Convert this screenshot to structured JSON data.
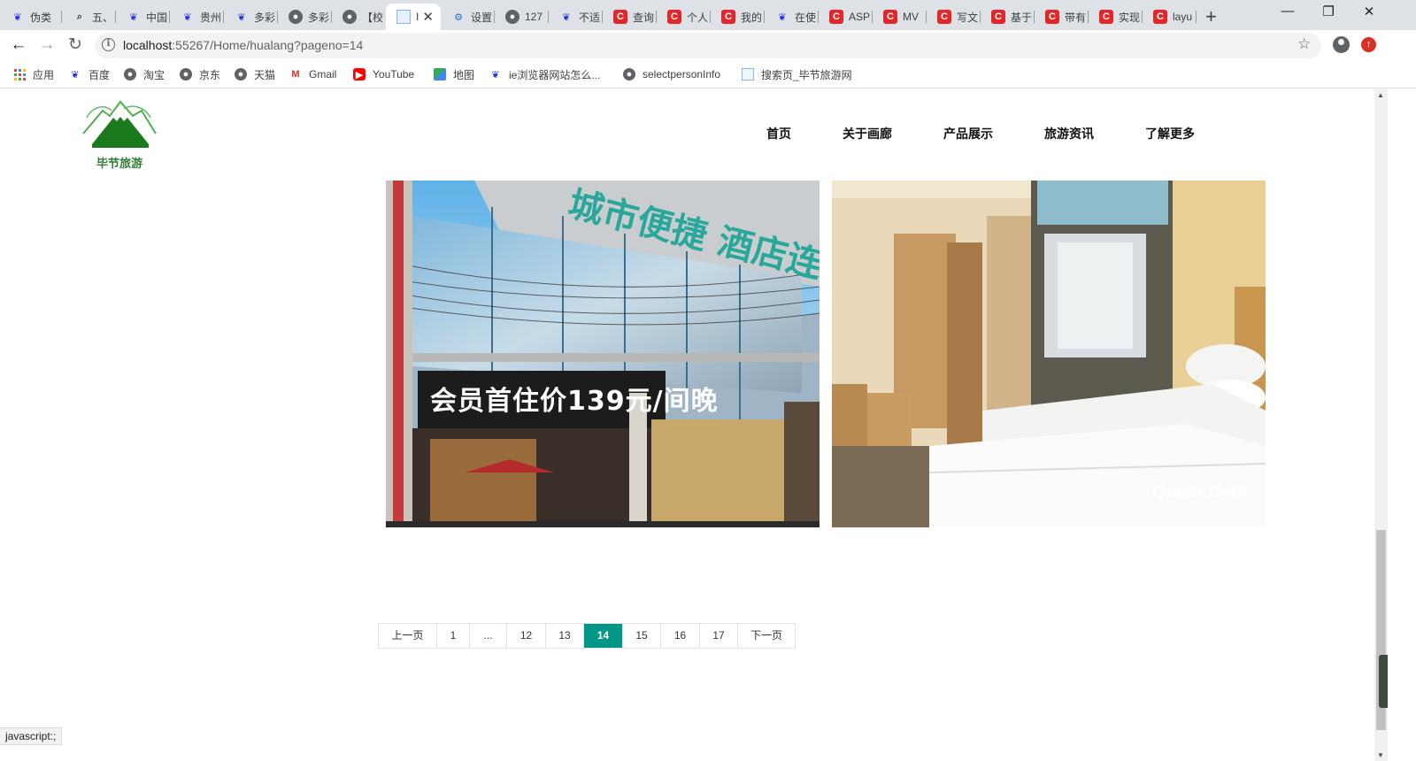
{
  "browser": {
    "tabs": [
      {
        "label": "伪类",
        "icon": "baidu-paw-icon"
      },
      {
        "label": "五、",
        "icon": "search-icon"
      },
      {
        "label": "中国",
        "icon": "baidu-paw-icon"
      },
      {
        "label": "贵州",
        "icon": "baidu-paw-icon"
      },
      {
        "label": "多彩",
        "icon": "baidu-paw-icon"
      },
      {
        "label": "多彩",
        "icon": "globe-icon"
      },
      {
        "label": "【校",
        "icon": "globe-icon"
      },
      {
        "label": "I",
        "icon": "document-icon",
        "active": true
      },
      {
        "label": "设置",
        "icon": "gear-icon"
      },
      {
        "label": "127",
        "icon": "globe-icon"
      },
      {
        "label": "不适",
        "icon": "baidu-paw-icon"
      },
      {
        "label": "查询",
        "icon": "csdn-icon"
      },
      {
        "label": "个人",
        "icon": "csdn-icon"
      },
      {
        "label": "我的",
        "icon": "csdn-icon"
      },
      {
        "label": "在使",
        "icon": "baidu-paw-icon"
      },
      {
        "label": "ASP",
        "icon": "csdn-icon"
      },
      {
        "label": "MV",
        "icon": "csdn-icon"
      },
      {
        "label": "写文",
        "icon": "csdn-icon"
      },
      {
        "label": "基于",
        "icon": "csdn-icon"
      },
      {
        "label": "带有",
        "icon": "csdn-icon"
      },
      {
        "label": "实现",
        "icon": "csdn-icon"
      },
      {
        "label": "layu",
        "icon": "csdn-icon"
      }
    ],
    "url_host": "localhost",
    "url_path": ":55267/Home/hualang?pageno=14",
    "bookmarks": [
      {
        "label": "应用",
        "icon": "apps-grid-icon"
      },
      {
        "label": "百度",
        "icon": "baidu-paw-icon"
      },
      {
        "label": "淘宝",
        "icon": "globe-icon"
      },
      {
        "label": "京东",
        "icon": "globe-icon"
      },
      {
        "label": "天猫",
        "icon": "globe-icon"
      },
      {
        "label": "Gmail",
        "icon": "gmail-icon"
      },
      {
        "label": "YouTube",
        "icon": "youtube-icon"
      },
      {
        "label": "地图",
        "icon": "maps-icon"
      },
      {
        "label": "ie浏览器网站怎么...",
        "icon": "baidu-paw-icon"
      },
      {
        "label": "selectpersonInfo",
        "icon": "globe-icon"
      },
      {
        "label": "搜索页_毕节旅游网",
        "icon": "document-icon"
      }
    ],
    "status_text": "javascript:;"
  },
  "site": {
    "logo_text": "毕节旅游",
    "nav": [
      "首页",
      "关于画廊",
      "产品展示",
      "旅游资讯",
      "了解更多"
    ]
  },
  "gallery": {
    "left_sign": "会员首住价139元/间晚",
    "left_roof": "城市便捷 酒店连锁",
    "right_watermark": "Qunar.Com"
  },
  "pagination": {
    "prev": "上一页",
    "first": "1",
    "ellipsis": "...",
    "pages": [
      "12",
      "13",
      "14",
      "15",
      "16",
      "17"
    ],
    "current": "14",
    "next": "下一页"
  },
  "colors": {
    "accent": "#009688",
    "tabbar": "#dee1e6",
    "logo_green": "#2e7d32"
  }
}
